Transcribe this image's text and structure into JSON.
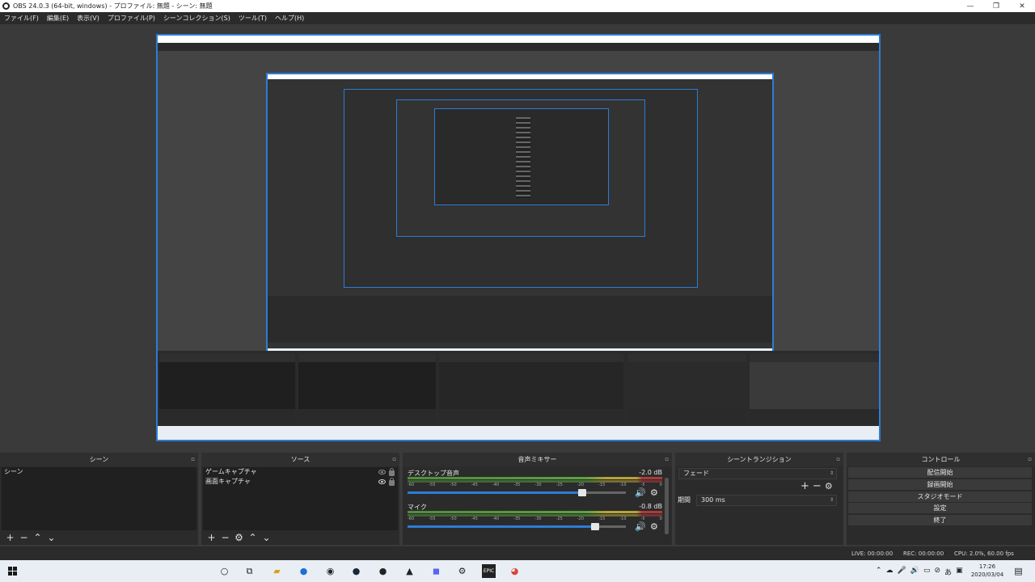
{
  "window": {
    "title": "OBS 24.0.3 (64-bit, windows) - プロファイル: 無題 - シーン: 無題",
    "controls": [
      "—",
      "❐",
      "✕"
    ]
  },
  "menu": [
    "ファイル(F)",
    "編集(E)",
    "表示(V)",
    "プロファイル(P)",
    "シーンコレクション(S)",
    "ツール(T)",
    "ヘルプ(H)"
  ],
  "docks": {
    "scenes": {
      "title": "シーン",
      "items": [
        "シーン"
      ]
    },
    "sources": {
      "title": "ソース",
      "items": [
        "ゲームキャプチャ",
        "画面キャプチャ"
      ]
    },
    "mixer": {
      "title": "音声ミキサー",
      "channels": [
        {
          "name": "デスクトップ音声",
          "db": "-2.0 dB",
          "volume": 0.8
        },
        {
          "name": "マイク",
          "db": "-0.8 dB",
          "volume": 0.86
        }
      ],
      "ticks": [
        "-60",
        "-55",
        "-50",
        "-45",
        "-40",
        "-35",
        "-30",
        "-25",
        "-20",
        "-15",
        "-10",
        "-5",
        "0"
      ]
    },
    "transitions": {
      "title": "シーントランジション",
      "selected": "フェード",
      "duration_label": "期間",
      "duration_value": "300 ms"
    },
    "controls": {
      "title": "コントロール",
      "buttons": [
        "配信開始",
        "録画開始",
        "スタジオモード",
        "設定",
        "終了"
      ]
    }
  },
  "status": {
    "live": "LIVE: 00:00:00",
    "rec": "REC: 00:00:00",
    "cpu": "CPU: 2.0%, 60.00 fps"
  },
  "taskbar": {
    "time": "17:26",
    "date": "2020/03/04",
    "icons": [
      "windows-start",
      "cortana",
      "task-view",
      "file-explorer",
      "app-blue",
      "browser",
      "steam",
      "app-dark",
      "photos",
      "discord",
      "settings",
      "epic",
      "chrome"
    ]
  }
}
